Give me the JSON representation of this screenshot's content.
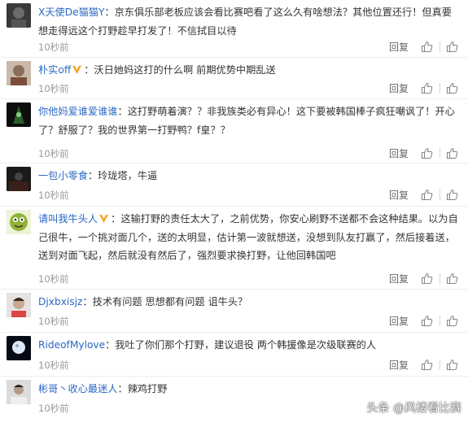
{
  "comments": [
    {
      "name": "X天使De猫猫Y",
      "vip": false,
      "text": "京东俱乐部老板应该会看比赛吧看了这么久有啥想法？其他位置还行！但真要想走得远这个打野趁早打发了！不信拭目以待",
      "time": "10秒前",
      "reply": "回复"
    },
    {
      "name": "朴实off",
      "vip": true,
      "text": "沃日她妈这打的什么啊 前期优势中期乱送",
      "time": "10秒前",
      "reply": "回复"
    },
    {
      "name": "你他妈爱谁爱谁谁",
      "vip": false,
      "text": "这打野萌着演？？非我族类必有异心！这下要被韩国棒子疯狂嘲讽了！开心了？舒服了？我的世界第一打野鸭？f皇？？",
      "time": "10秒前",
      "reply": "回复"
    },
    {
      "name": "一包小零食",
      "vip": false,
      "text": "玲珑塔，牛逼",
      "time": "10秒前",
      "reply": "回复"
    },
    {
      "name": "请叫我牛头人",
      "vip": true,
      "text": "这输打野的责任太大了，之前优势，你安心刷野不送都不会这种结果。以为自己很牛，一个挑对面几个，送的太明显，估计第一波就想送，没想到队友打赢了，然后接着送，送到对面飞起，然后就没有然后了，强烈要求换打野，让他回韩国吧",
      "time": "10秒前",
      "reply": "回复"
    },
    {
      "name": "Djxbxisjz",
      "vip": false,
      "text": "技术有问题 思想都有问题 诅牛头？",
      "time": "10秒前",
      "reply": "回复"
    },
    {
      "name": "RideofMylove",
      "vip": false,
      "text": "我吐了你们那个打野，建议退役 两个韩援像是次级联赛的人",
      "time": "10秒前",
      "reply": "回复"
    },
    {
      "name": "彬哥丶收心最迷人",
      "vip": false,
      "text": "辣鸡打野",
      "time": "10秒前",
      "reply": "回复"
    }
  ],
  "watermark": "头条 @风楼看比赛",
  "colors": {
    "name": "#2a67c4",
    "time": "#999999",
    "vip_badge": "#f5a623"
  }
}
